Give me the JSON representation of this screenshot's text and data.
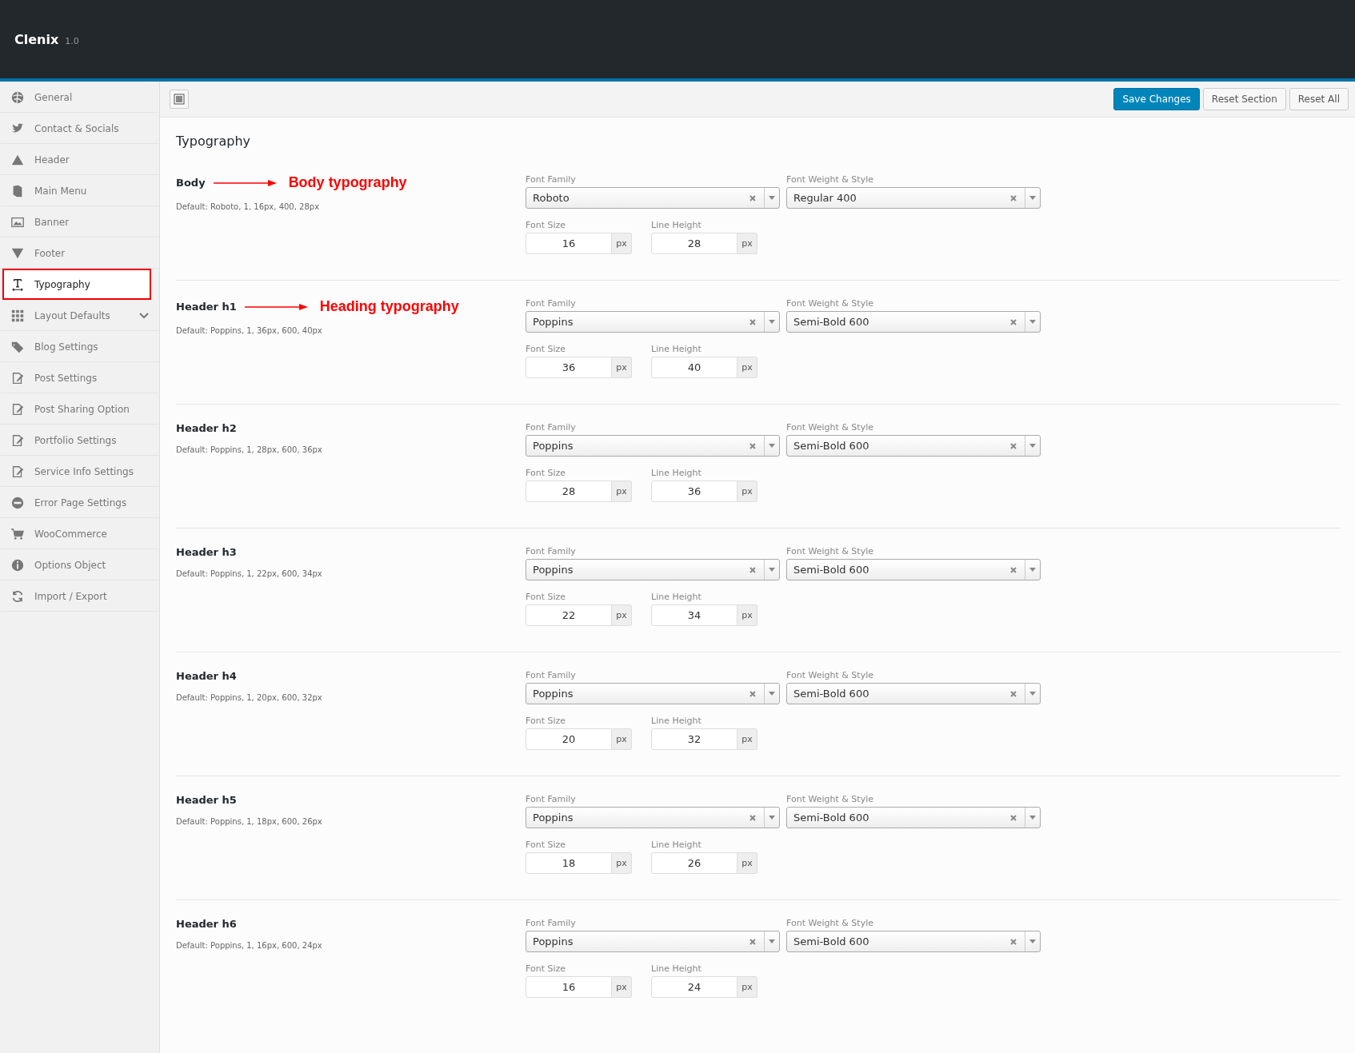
{
  "header": {
    "title": "Clenix",
    "version": "1.0"
  },
  "sidebar": {
    "items": [
      {
        "label": "General",
        "selected": false,
        "submenu": false
      },
      {
        "label": "Contact & Socials",
        "selected": false,
        "submenu": false
      },
      {
        "label": "Header",
        "selected": false,
        "submenu": false
      },
      {
        "label": "Main Menu",
        "selected": false,
        "submenu": false
      },
      {
        "label": "Banner",
        "selected": false,
        "submenu": false
      },
      {
        "label": "Footer",
        "selected": false,
        "submenu": false
      },
      {
        "label": "Typography",
        "selected": true,
        "submenu": false
      },
      {
        "label": "Layout Defaults",
        "selected": false,
        "submenu": true
      },
      {
        "label": "Blog Settings",
        "selected": false,
        "submenu": false
      },
      {
        "label": "Post Settings",
        "selected": false,
        "submenu": false
      },
      {
        "label": "Post Sharing Option",
        "selected": false,
        "submenu": false
      },
      {
        "label": "Portfolio Settings",
        "selected": false,
        "submenu": false
      },
      {
        "label": "Service Info Settings",
        "selected": false,
        "submenu": false
      },
      {
        "label": "Error Page Settings",
        "selected": false,
        "submenu": false
      },
      {
        "label": "WooCommerce",
        "selected": false,
        "submenu": false
      },
      {
        "label": "Options Object",
        "selected": false,
        "submenu": false
      },
      {
        "label": "Import / Export",
        "selected": false,
        "submenu": false
      }
    ]
  },
  "toolbar": {
    "buttons": [
      {
        "label": "Save Changes",
        "kind": "primary"
      },
      {
        "label": "Reset Section",
        "kind": "secondary"
      },
      {
        "label": "Reset All",
        "kind": "secondary"
      }
    ]
  },
  "page_title": "Typography",
  "sections": [
    {
      "name": "Body",
      "annotation": "Body typography",
      "default": "Default: Roboto, 1, 16px, 400, 28px",
      "family_label": "Font Family",
      "family": "Roboto",
      "weight_label": "Font Weight & Style",
      "weight": "Regular 400",
      "size_label": "Font Size",
      "size": "16",
      "size_unit": "px",
      "line_label": "Line Height",
      "line": "28",
      "line_unit": "px"
    },
    {
      "name": "Header h1",
      "annotation": "Heading typography",
      "default": "Default: Poppins, 1, 36px, 600, 40px",
      "family_label": "Font Family",
      "family": "Poppins",
      "weight_label": "Font Weight & Style",
      "weight": "Semi-Bold 600",
      "size_label": "Font Size",
      "size": "36",
      "size_unit": "px",
      "line_label": "Line Height",
      "line": "40",
      "line_unit": "px"
    },
    {
      "name": "Header h2",
      "default": "Default: Poppins, 1, 28px, 600, 36px",
      "family_label": "Font Family",
      "family": "Poppins",
      "weight_label": "Font Weight & Style",
      "weight": "Semi-Bold 600",
      "size_label": "Font Size",
      "size": "28",
      "size_unit": "px",
      "line_label": "Line Height",
      "line": "36",
      "line_unit": "px"
    },
    {
      "name": "Header h3",
      "default": "Default: Poppins, 1, 22px, 600, 34px",
      "family_label": "Font Family",
      "family": "Poppins",
      "weight_label": "Font Weight & Style",
      "weight": "Semi-Bold 600",
      "size_label": "Font Size",
      "size": "22",
      "size_unit": "px",
      "line_label": "Line Height",
      "line": "34",
      "line_unit": "px"
    },
    {
      "name": "Header h4",
      "default": "Default: Poppins, 1, 20px, 600, 32px",
      "family_label": "Font Family",
      "family": "Poppins",
      "weight_label": "Font Weight & Style",
      "weight": "Semi-Bold 600",
      "size_label": "Font Size",
      "size": "20",
      "size_unit": "px",
      "line_label": "Line Height",
      "line": "32",
      "line_unit": "px"
    },
    {
      "name": "Header h5",
      "default": "Default: Poppins, 1, 18px, 600, 26px",
      "family_label": "Font Family",
      "family": "Poppins",
      "weight_label": "Font Weight & Style",
      "weight": "Semi-Bold 600",
      "size_label": "Font Size",
      "size": "18",
      "size_unit": "px",
      "line_label": "Line Height",
      "line": "26",
      "line_unit": "px"
    },
    {
      "name": "Header h6",
      "default": "Default: Poppins, 1, 16px, 600, 24px",
      "family_label": "Font Family",
      "family": "Poppins",
      "weight_label": "Font Weight & Style",
      "weight": "Semi-Bold 600",
      "size_label": "Font Size",
      "size": "16",
      "size_unit": "px",
      "line_label": "Line Height",
      "line": "24",
      "line_unit": "px"
    }
  ]
}
